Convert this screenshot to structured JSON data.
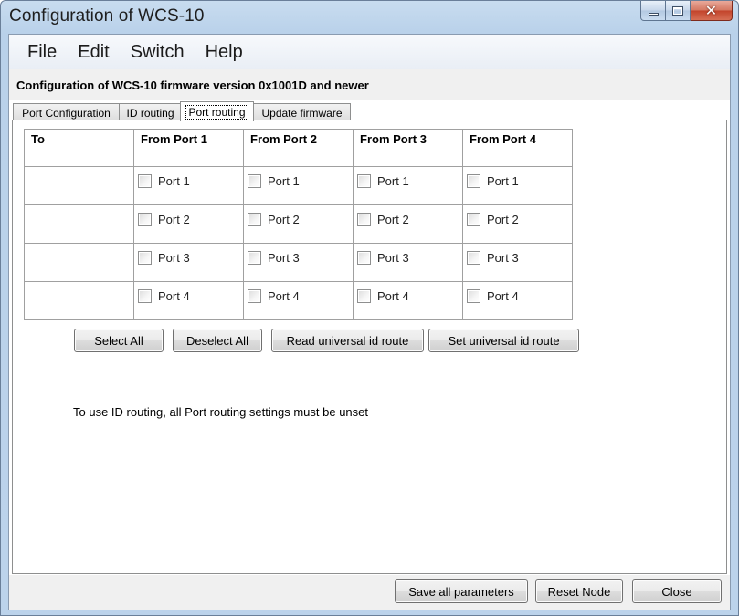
{
  "window": {
    "title": "Configuration of WCS-10",
    "controls": {
      "minimize_icon": "minimize-icon",
      "maximize_icon": "maximize-icon",
      "close_glyph": "✕"
    }
  },
  "menu": [
    "File",
    "Edit",
    "Switch",
    "Help"
  ],
  "heading": "Configuration of WCS-10 firmware version 0x1001D and newer",
  "tabs": [
    {
      "label": "Port Configuration",
      "active": false
    },
    {
      "label": "ID routing",
      "active": false
    },
    {
      "label": "Port routing",
      "active": true
    },
    {
      "label": "Update firmware",
      "active": false
    }
  ],
  "routing_table": {
    "headers": [
      "To",
      "From Port 1",
      "From Port 2",
      "From Port 3",
      "From Port 4"
    ],
    "rows": [
      {
        "to": "",
        "cells": [
          {
            "label": "Port 1",
            "checked": false
          },
          {
            "label": "Port 1",
            "checked": false
          },
          {
            "label": "Port 1",
            "checked": false
          },
          {
            "label": "Port 1",
            "checked": false
          }
        ]
      },
      {
        "to": "",
        "cells": [
          {
            "label": "Port 2",
            "checked": false
          },
          {
            "label": "Port 2",
            "checked": false
          },
          {
            "label": "Port 2",
            "checked": false
          },
          {
            "label": "Port 2",
            "checked": false
          }
        ]
      },
      {
        "to": "",
        "cells": [
          {
            "label": "Port 3",
            "checked": false
          },
          {
            "label": "Port 3",
            "checked": false
          },
          {
            "label": "Port 3",
            "checked": false
          },
          {
            "label": "Port 3",
            "checked": false
          }
        ]
      },
      {
        "to": "",
        "cells": [
          {
            "label": "Port 4",
            "checked": false
          },
          {
            "label": "Port 4",
            "checked": false
          },
          {
            "label": "Port 4",
            "checked": false
          },
          {
            "label": "Port 4",
            "checked": false
          }
        ]
      }
    ]
  },
  "buttons": {
    "select_all": "Select All",
    "deselect_all": "Deselect All",
    "read_universal": "Read universal id route",
    "set_universal": "Set universal id route"
  },
  "note": "To use ID routing, all Port routing settings must be unset",
  "footer": {
    "save": "Save all parameters",
    "reset": "Reset Node",
    "close": "Close"
  }
}
